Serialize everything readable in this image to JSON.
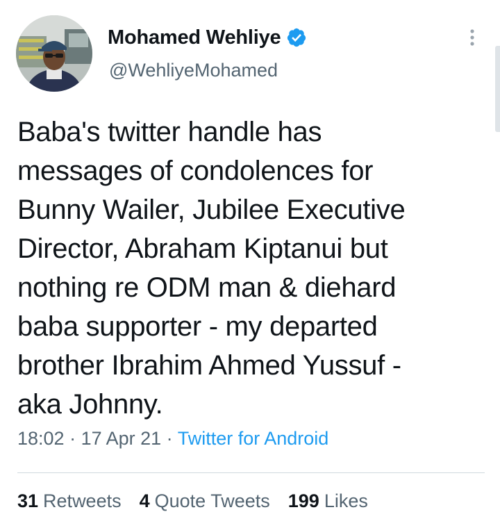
{
  "author": {
    "display_name": "Mohamed Wehliye",
    "handle": "@WehliyeMohamed",
    "verified": true
  },
  "tweet": {
    "text": "Baba's twitter handle has\nmessages of condolences for\nBunny Wailer, Jubilee Executive\nDirector, Abraham Kiptanui but\nnothing re ODM man & diehard\nbaba supporter - my departed\nbrother Ibrahim Ahmed Yussuf -\naka Johnny."
  },
  "meta": {
    "time": "18:02",
    "separator": " · ",
    "date": "17 Apr 21",
    "source": "Twitter for Android"
  },
  "stats": {
    "retweets_count": "31",
    "retweets_label": "Retweets",
    "quotes_count": "4",
    "quotes_label": "Quote Tweets",
    "likes_count": "199",
    "likes_label": "Likes"
  },
  "icons": {
    "verified": "verified-badge-icon",
    "more": "more-vertical-icon"
  },
  "colors": {
    "accent": "#1d9bf0",
    "secondary_text": "#536471",
    "primary_text": "#0f1419"
  }
}
